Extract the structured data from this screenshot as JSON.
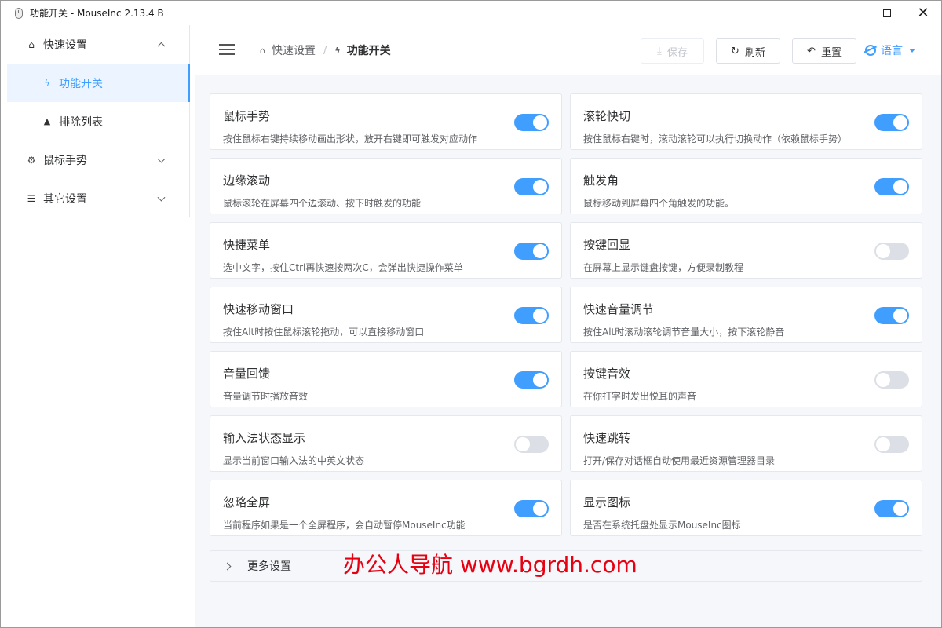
{
  "window": {
    "title": "功能开关 - MouseInc 2.13.4 B",
    "controls": {
      "minimize": "",
      "maximize": "",
      "close": "✕"
    }
  },
  "sidebar": {
    "groups": [
      {
        "label": "快速设置",
        "icon": "home-icon",
        "expanded": true
      },
      {
        "label": "鼠标手势",
        "icon": "gear-icon",
        "expanded": false
      },
      {
        "label": "其它设置",
        "icon": "sliders-icon",
        "expanded": false
      }
    ],
    "sub_items": [
      {
        "label": "功能开关",
        "icon": "lightning-icon",
        "active": true
      },
      {
        "label": "排除列表",
        "icon": "warning-icon",
        "active": false
      }
    ]
  },
  "header": {
    "breadcrumb": [
      {
        "label": "快速设置",
        "icon": "home-icon"
      },
      {
        "label": "功能开关",
        "icon": "lightning-icon"
      }
    ],
    "breadcrumb_sep": "/",
    "buttons": {
      "save": "保存",
      "refresh": "刷新",
      "reset": "重置"
    },
    "language": "语言"
  },
  "features": [
    {
      "title": "鼠标手势",
      "desc": "按住鼠标右键持续移动画出形状，放开右键即可触发对应动作",
      "enabled": true
    },
    {
      "title": "滚轮快切",
      "desc": "按住鼠标右键时，滚动滚轮可以执行切换动作（依赖鼠标手势）",
      "enabled": true
    },
    {
      "title": "边缘滚动",
      "desc": "鼠标滚轮在屏幕四个边滚动、按下时触发的功能",
      "enabled": true
    },
    {
      "title": "触发角",
      "desc": "鼠标移动到屏幕四个角触发的功能。",
      "enabled": true
    },
    {
      "title": "快捷菜单",
      "desc": "选中文字，按住Ctrl再快速按两次C，会弹出快捷操作菜单",
      "enabled": true
    },
    {
      "title": "按键回显",
      "desc": "在屏幕上显示键盘按键，方便录制教程",
      "enabled": false
    },
    {
      "title": "快速移动窗口",
      "desc": "按住Alt时按住鼠标滚轮拖动，可以直接移动窗口",
      "enabled": true
    },
    {
      "title": "快速音量调节",
      "desc": "按住Alt时滚动滚轮调节音量大小，按下滚轮静音",
      "enabled": true
    },
    {
      "title": "音量回馈",
      "desc": "音量调节时播放音效",
      "enabled": true
    },
    {
      "title": "按键音效",
      "desc": "在你打字时发出悦耳的声音",
      "enabled": false
    },
    {
      "title": "输入法状态显示",
      "desc": "显示当前窗口输入法的中英文状态",
      "enabled": false
    },
    {
      "title": "快速跳转",
      "desc": "打开/保存对话框自动使用最近资源管理器目录",
      "enabled": false
    },
    {
      "title": "忽略全屏",
      "desc": "当前程序如果是一个全屏程序，会自动暂停MouseInc功能",
      "enabled": true
    },
    {
      "title": "显示图标",
      "desc": "是否在系统托盘处显示MouseInc图标",
      "enabled": true
    }
  ],
  "more": {
    "label": "更多设置"
  },
  "watermark": "办公人导航 www.bgrdh.com",
  "colors": {
    "accent": "#409eff",
    "switch_off": "#dcdfe6",
    "watermark": "#e60012"
  }
}
